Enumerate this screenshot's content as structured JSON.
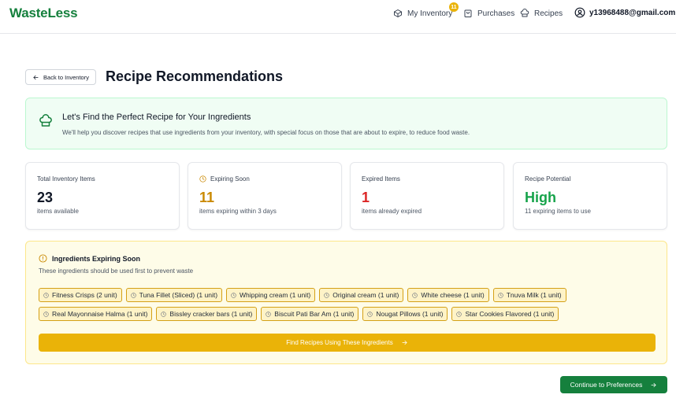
{
  "header": {
    "brand": "WasteLess",
    "nav": {
      "inventory": "My Inventory",
      "inventory_badge": "11",
      "purchases": "Purchases",
      "recipes": "Recipes"
    },
    "user_email": "y13968488@gmail.com"
  },
  "page": {
    "back_label": "Back to Inventory",
    "title": "Recipe Recommendations"
  },
  "intro": {
    "title": "Let's Find the Perfect Recipe for Your Ingredients",
    "description": "We'll help you discover recipes that use ingredients from your inventory, with special focus on those that are about to expire, to reduce food waste."
  },
  "stats": [
    {
      "label": "Total Inventory Items",
      "value": "23",
      "sub": "items available",
      "color": "#111827"
    },
    {
      "label": "Expiring Soon",
      "value": "11",
      "sub": "items expiring within 3 days",
      "color": "#ca8a04",
      "icon": "clock-icon"
    },
    {
      "label": "Expired Items",
      "value": "1",
      "sub": "items already expired",
      "color": "#dc2626"
    },
    {
      "label": "Recipe Potential",
      "value": "High",
      "sub": "11 expiring items to use",
      "color": "#16a34a"
    }
  ],
  "expiring": {
    "title": "Ingredients Expiring Soon",
    "subtitle": "These ingredients should be used first to prevent waste",
    "items": [
      "Fitness Crisps (2 unit)",
      "Tuna Fillet (Sliced) (1 unit)",
      "Whipping cream (1 unit)",
      "Original cream (1 unit)",
      "White cheese (1 unit)",
      "Tnuva Milk (1 unit)",
      "Real Mayonnaise Halma (1 unit)",
      "Bissley cracker bars (1 unit)",
      "Biscuit Pati Bar Am (1 unit)",
      "Nougat Pillows (1 unit)",
      "Star Cookies Flavored (1 unit)"
    ],
    "find_button": "Find Recipes Using These Ingredients"
  },
  "continue_button": "Continue to Preferences",
  "colors": {
    "brand": "#15803d",
    "warning": "#eab308",
    "danger": "#dc2626",
    "success": "#16a34a"
  }
}
